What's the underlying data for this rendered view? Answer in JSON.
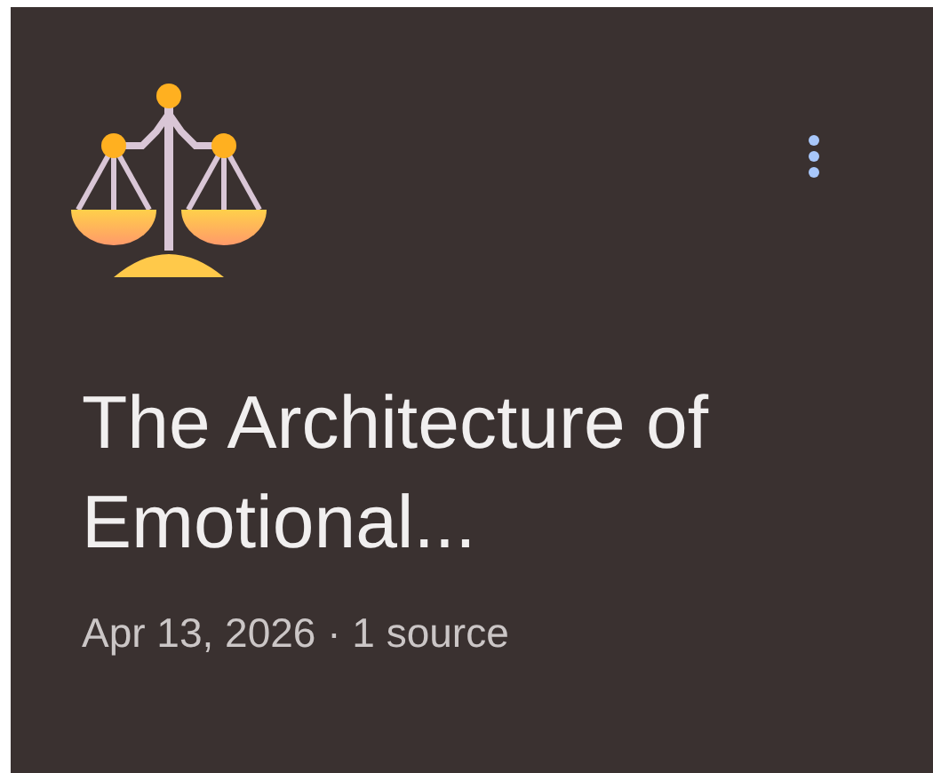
{
  "card": {
    "title": "The Architecture of Emotional...",
    "meta": "Apr 13, 2026 · 1 source"
  }
}
